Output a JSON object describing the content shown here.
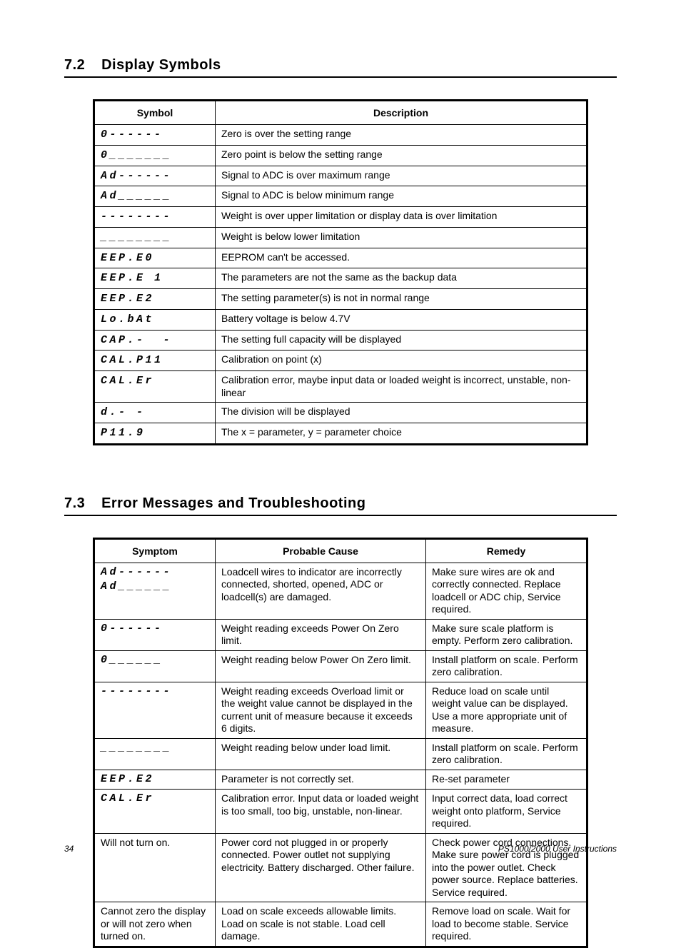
{
  "sections": {
    "displaySymbols": {
      "number": "7.2",
      "title": "Display Symbols"
    },
    "errorMessages": {
      "number": "7.3",
      "title": "Error Messages and Troubleshooting"
    }
  },
  "table1": {
    "headers": {
      "symbol": "Symbol",
      "description": "Description"
    },
    "rows": [
      {
        "symbol": "0------",
        "description": "Zero is over the setting range"
      },
      {
        "symbol": "0_______",
        "description": "Zero point is below the setting range"
      },
      {
        "symbol": "Ad------",
        "description": "Signal to ADC is over maximum range"
      },
      {
        "symbol": "Ad______",
        "description": "Signal to ADC is below minimum range"
      },
      {
        "symbol": "--------",
        "description": "Weight is over upper limitation or display data is over limitation"
      },
      {
        "symbol": "________",
        "description": "Weight is below lower limitation"
      },
      {
        "symbol": "EEP.E0",
        "description": "EEPROM can't be accessed."
      },
      {
        "symbol": "EEP.E 1",
        "description": "The parameters are not the same as the backup data"
      },
      {
        "symbol": "EEP.E2",
        "description": "The setting parameter(s) is not in normal range"
      },
      {
        "symbol": "Lo.bAt",
        "description": "Battery voltage is below 4.7V"
      },
      {
        "symbol": "CAP.-  -",
        "description": "The setting full capacity will be displayed"
      },
      {
        "symbol": "CAL.P11",
        "description": "Calibration on point (x)"
      },
      {
        "symbol": "CAL.Er",
        "description": "Calibration error, maybe input data or loaded weight is incorrect, unstable, non-linear"
      },
      {
        "symbol": "d.- -",
        "description": "The division will be displayed"
      },
      {
        "symbol": "P11.9",
        "description": "The x = parameter, y = parameter choice"
      }
    ]
  },
  "table2": {
    "headers": {
      "symptom": "Symptom",
      "cause": "Probable Cause",
      "remedy": "Remedy"
    },
    "rows": [
      {
        "symptom_lines": [
          "Ad------",
          "Ad______"
        ],
        "symptom_is_seg": true,
        "cause": "Loadcell wires to indicator are incorrectly connected, shorted, opened, ADC or loadcell(s) are damaged.",
        "remedy": "Make sure wires are ok and correctly connected. Replace loadcell or ADC chip, Service required."
      },
      {
        "symptom_lines": [
          "0------"
        ],
        "symptom_is_seg": true,
        "cause": "Weight reading exceeds Power On Zero limit.",
        "remedy": "Make sure scale platform is empty. Perform zero calibration."
      },
      {
        "symptom_lines": [
          "0______"
        ],
        "symptom_is_seg": true,
        "cause": "Weight reading below Power On Zero limit.",
        "remedy": "Install platform on scale. Perform zero calibration."
      },
      {
        "symptom_lines": [
          "--------"
        ],
        "symptom_is_seg": true,
        "cause": "Weight reading exceeds Overload limit or the weight value cannot be displayed in the current unit of measure because it exceeds 6 digits.",
        "remedy": "Reduce load on scale until weight value can be displayed. Use a more appropriate unit of measure."
      },
      {
        "symptom_lines": [
          "________"
        ],
        "symptom_is_seg": true,
        "cause": "Weight reading below under load limit.",
        "remedy": "Install platform on scale. Perform zero calibration."
      },
      {
        "symptom_lines": [
          "EEP.E2"
        ],
        "symptom_is_seg": true,
        "cause": "Parameter is not correctly set.",
        "remedy": "Re-set parameter"
      },
      {
        "symptom_lines": [
          "CAL.Er"
        ],
        "symptom_is_seg": true,
        "cause": "Calibration error. Input data or loaded weight is too small, too big, unstable, non-linear.",
        "remedy": "Input correct data, load correct weight onto platform, Service required."
      },
      {
        "symptom_lines": [
          "Will not turn on."
        ],
        "symptom_is_seg": false,
        "cause": "Power cord not plugged in or properly connected. Power outlet not supplying electricity. Battery discharged. Other failure.",
        "remedy": "Check power cord connections. Make sure power cord is plugged into the power outlet. Check power source. Replace batteries. Service required."
      },
      {
        "symptom_lines": [
          "Cannot zero the display or will not zero when turned on."
        ],
        "symptom_is_seg": false,
        "cause": "Load on scale exceeds allowable limits. Load on scale is not stable. Load cell damage.",
        "remedy": "Remove load on scale. Wait for load to become stable. Service required."
      }
    ]
  },
  "footer": {
    "page": "34",
    "doc": "PS1000/2000 User Instructions"
  }
}
